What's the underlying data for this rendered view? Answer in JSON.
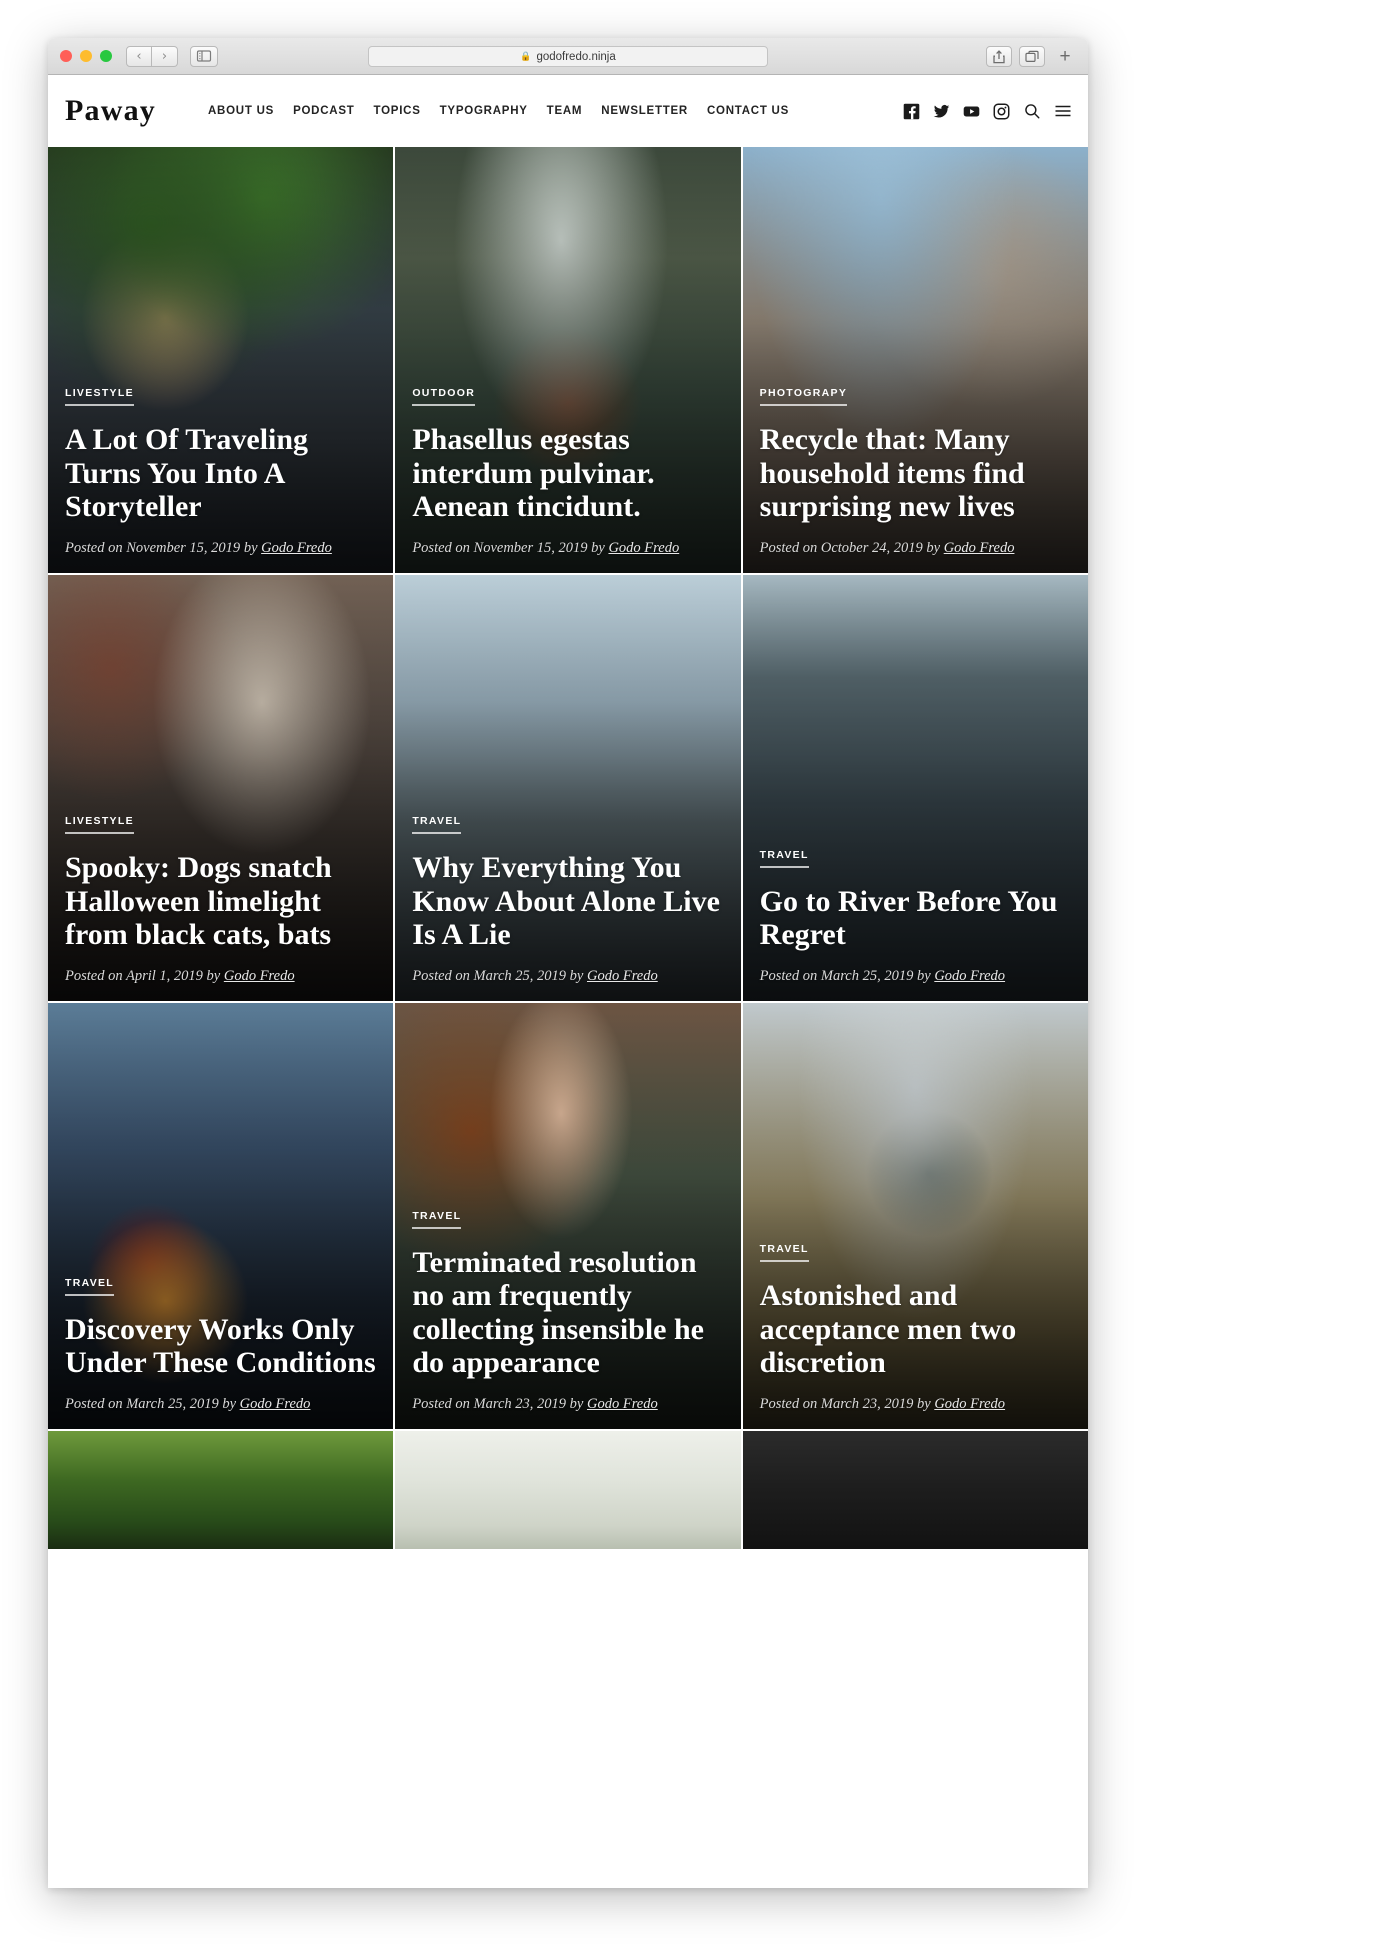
{
  "browser": {
    "url": "godofredo.ninja",
    "lock_icon": "lock-icon",
    "back_label": "‹",
    "forward_label": "›",
    "sidebar_icon": "sidebar-icon",
    "share_icon": "share-icon",
    "tabs_icon": "tabs-overview-icon",
    "new_tab_label": "+"
  },
  "site": {
    "logo": "Paway",
    "nav": [
      {
        "label": "ABOUT US"
      },
      {
        "label": "PODCAST"
      },
      {
        "label": "TOPICS"
      },
      {
        "label": "TYPOGRAPHY"
      },
      {
        "label": "TEAM"
      },
      {
        "label": "NEWSLETTER"
      },
      {
        "label": "CONTACT US"
      }
    ],
    "social": [
      {
        "name": "facebook-icon"
      },
      {
        "name": "twitter-icon"
      },
      {
        "name": "youtube-icon"
      },
      {
        "name": "instagram-icon"
      }
    ],
    "actions": [
      {
        "name": "search-icon"
      },
      {
        "name": "menu-icon"
      }
    ]
  },
  "posts": [
    {
      "category": "LIVESTYLE",
      "title": "A Lot Of Traveling Turns You Into A Storyteller",
      "posted_prefix": "Posted on",
      "date": "November 15, 2019",
      "by": "by",
      "author": "Godo Fredo",
      "photo": "ph-1"
    },
    {
      "category": "OUTDOOR",
      "title": "Phasellus egestas interdum pulvinar. Aenean tincidunt.",
      "posted_prefix": "Posted on",
      "date": "November 15, 2019",
      "by": "by",
      "author": "Godo Fredo",
      "photo": "ph-2"
    },
    {
      "category": "PHOTOGRAPY",
      "title": "Recycle that: Many household items find surprising new lives",
      "posted_prefix": "Posted on",
      "date": "October 24, 2019",
      "by": "by",
      "author": "Godo Fredo",
      "photo": "ph-3"
    },
    {
      "category": "LIVESTYLE",
      "title": "Spooky: Dogs snatch Halloween limelight from black cats, bats",
      "posted_prefix": "Posted on",
      "date": "April 1, 2019",
      "by": "by",
      "author": "Godo Fredo",
      "photo": "ph-4"
    },
    {
      "category": "TRAVEL",
      "title": "Why Everything You Know About Alone Live Is A Lie",
      "posted_prefix": "Posted on",
      "date": "March 25, 2019",
      "by": "by",
      "author": "Godo Fredo",
      "photo": "ph-5"
    },
    {
      "category": "TRAVEL",
      "title": "Go to River Before You Regret",
      "posted_prefix": "Posted on",
      "date": "March 25, 2019",
      "by": "by",
      "author": "Godo Fredo",
      "photo": "ph-6"
    },
    {
      "category": "TRAVEL",
      "title": "Discovery Works Only Under These Conditions",
      "posted_prefix": "Posted on",
      "date": "March 25, 2019",
      "by": "by",
      "author": "Godo Fredo",
      "photo": "ph-7"
    },
    {
      "category": "TRAVEL",
      "title": "Terminated resolution no am frequently collecting insensible he do appearance",
      "posted_prefix": "Posted on",
      "date": "March 23, 2019",
      "by": "by",
      "author": "Godo Fredo",
      "photo": "ph-8"
    },
    {
      "category": "TRAVEL",
      "title": "Astonished and acceptance men two discretion",
      "posted_prefix": "Posted on",
      "date": "March 23, 2019",
      "by": "by",
      "author": "Godo Fredo",
      "photo": "ph-9"
    }
  ],
  "partial_row": [
    {
      "photo": "ph-10"
    },
    {
      "photo": "ph-11"
    },
    {
      "photo": "ph-12"
    }
  ]
}
